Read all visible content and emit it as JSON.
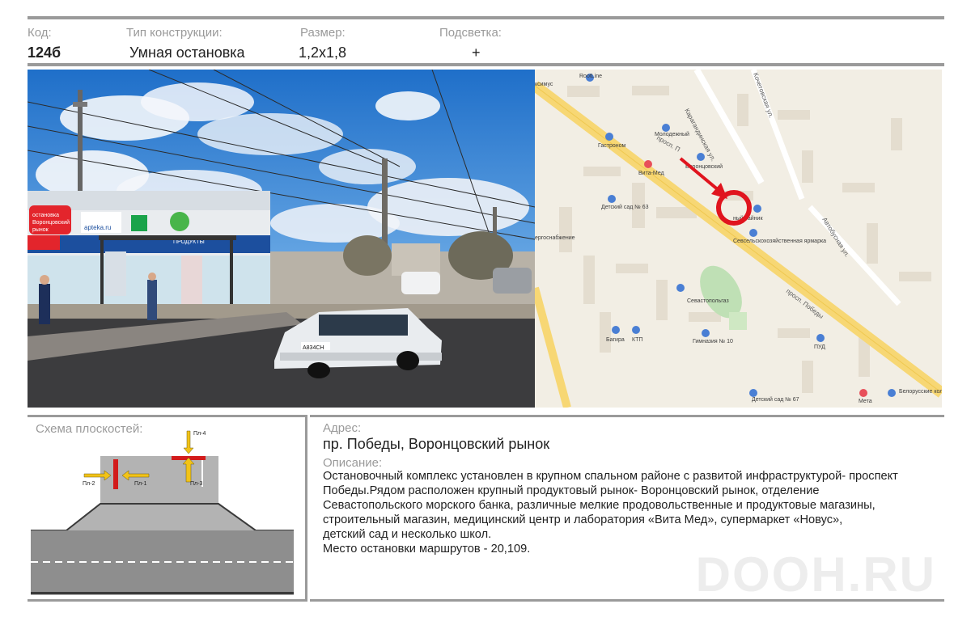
{
  "header": {
    "code_label": "Код:",
    "code_value": "124б",
    "type_label": "Тип конструкции:",
    "type_value": "Умная остановка",
    "size_label": "Размер:",
    "size_value": "1,2x1,8",
    "light_label": "Подсветка:",
    "light_value": "+"
  },
  "photo": {
    "store_name_line1": "остановка",
    "store_name_line2": "Воронцовский",
    "store_name_line3": "рынок",
    "pharmacy_url": "apteka.ru",
    "banner_text": "ПРОДУКТЫ",
    "plate_text": "А834СН"
  },
  "map": {
    "labels": {
      "rootline": "RootLine",
      "molodezhny": "Молодежный",
      "gastronom": "Гастроном",
      "vita_med": "Вита-Мед",
      "voronts": "Воронцовский",
      "sad63": "Детский сад № 63",
      "prosp_top": "просп. П",
      "karaganda": "Карагандинская ул.",
      "kochetov": "Кочетовская ул.",
      "tayn": "ный тайник",
      "selhoz": "Севсельскохозяйственная ярмарка",
      "aytodor": "Автобусная ул.",
      "sevgaz": "Севастопольгаз",
      "prosp_pobedy": "просп. Победы",
      "bagira": "Багира",
      "ktp": "КТП",
      "gimnazia": "Гимназия № 10",
      "pud": "ПУД",
      "sad67": "Детский сад № 67",
      "meta": "Мета",
      "belorus": "Белорусские колбасы",
      "stroi": "ергоснабжение",
      "ksimus": "ксимус"
    },
    "accent_color": "#e0141e"
  },
  "scheme": {
    "title": "Схема плоскостей:",
    "pl1": "Пл-1",
    "pl2": "Пл-2",
    "pl3": "Пл-3",
    "pl4": "Пл-4"
  },
  "info": {
    "address_label": "Адрес:",
    "address_value": "пр. Победы, Воронцовский рынок",
    "description_label": "Описание:",
    "description_lines": [
      "Остановочный комплекс установлен в крупном спальном районе  с развитой инфраструктурой- проспект",
      "Победы.Рядом расположен   крупный продуктовый рынок- Воронцовский рынок, отделение",
      "Севастопольского морского банка, различные мелкие продовольственные и продуктовые магазины,",
      "строительный магазин, медицинский центр и лаборатория «Вита Мед»,  супермаркет «Новус»,",
      "детский сад и несколько школ.",
      "Место остановки маршрутов -  20,109."
    ],
    "watermark": "DOOH.RU"
  }
}
